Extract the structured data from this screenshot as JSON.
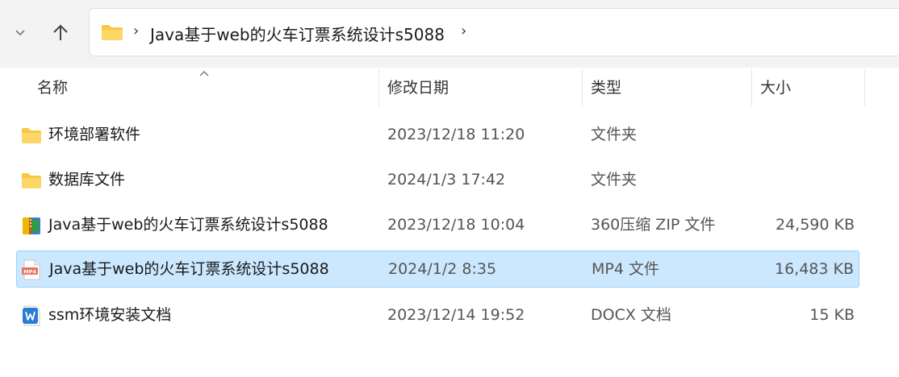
{
  "address": {
    "path": "Java基于web的火车订票系统设计s5088",
    "separator": "›"
  },
  "columns": {
    "name": "名称",
    "modified": "修改日期",
    "type": "类型",
    "size": "大小"
  },
  "files": [
    {
      "name": "环境部署软件",
      "modified": "2023/12/18 11:20",
      "type": "文件夹",
      "size": "",
      "icon": "folder-icon",
      "selected": false
    },
    {
      "name": "数据库文件",
      "modified": "2024/1/3 17:42",
      "type": "文件夹",
      "size": "",
      "icon": "folder-icon",
      "selected": false
    },
    {
      "name": "Java基于web的火车订票系统设计s5088",
      "modified": "2023/12/18 10:04",
      "type": "360压缩 ZIP 文件",
      "size": "24,590 KB",
      "icon": "zip-archive-icon",
      "selected": false
    },
    {
      "name": "Java基于web的火车订票系统设计s5088",
      "modified": "2024/1/2 8:35",
      "type": "MP4 文件",
      "size": "16,483 KB",
      "icon": "mp4-file-icon",
      "selected": true
    },
    {
      "name": "ssm环境安装文档",
      "modified": "2023/12/14 19:52",
      "type": "DOCX 文档",
      "size": "15 KB",
      "icon": "word-document-icon",
      "selected": false
    }
  ],
  "colors": {
    "selection": "#cce8ff",
    "selection_border": "#99d1ff",
    "folder": "#f8c842",
    "toolbar_bg": "#f3f3f3"
  }
}
